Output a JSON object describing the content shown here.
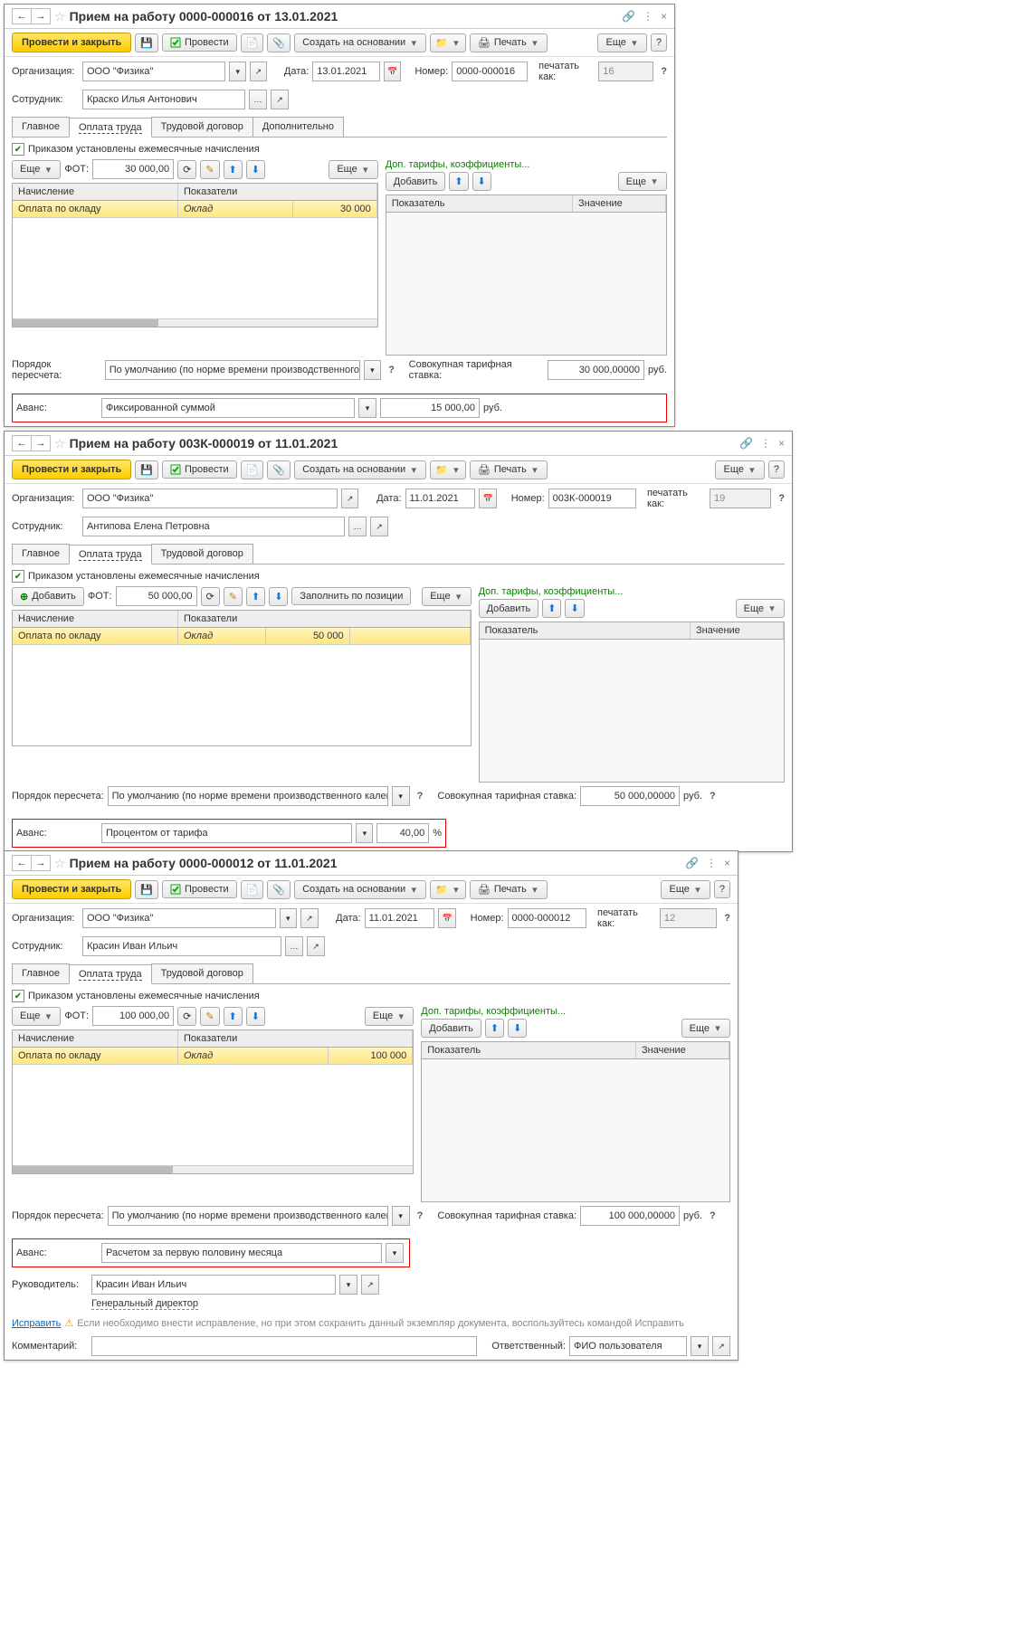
{
  "common": {
    "post_close": "Провести и закрыть",
    "post": "Провести",
    "create_based": "Создать на основании",
    "print": "Печать",
    "more": "Еще",
    "help": "?",
    "org_lbl": "Организация:",
    "emp_lbl": "Сотрудник:",
    "date_lbl": "Дата:",
    "num_lbl": "Номер:",
    "print_as_lbl": "печатать как:",
    "tab_main": "Главное",
    "tab_pay": "Оплата труда",
    "tab_contract": "Трудовой договор",
    "tab_extra": "Дополнительно",
    "monthly_check": "Приказом установлены ежемесячные начисления",
    "fot_lbl": "ФОТ:",
    "fill_pos": "Заполнить по позиции",
    "add": "Добавить",
    "col_accrual": "Начисление",
    "col_indicators": "Показатели",
    "col_indicator": "Показатель",
    "col_value": "Значение",
    "dop_tarif": "Доп. тарифы, коэффициенты...",
    "recalc_order_lbl": "Порядок пересчета:",
    "recalc_option": "По умолчанию (по норме времени производственного кале",
    "recalc_option2": "По умолчанию (по норме времени производственного календар",
    "cumul_rate_lbl": "Совокупная тарифная ставка:",
    "rub": "руб.",
    "advance_lbl": "Аванс:",
    "row_accrual": "Оплата по окладу",
    "row_indic": "Оклад"
  },
  "w1": {
    "title": "Прием на работу 0000-000016 от 13.01.2021",
    "org": "ООО \"Физика\"",
    "employee": "Краско Илья Антонович",
    "date": "13.01.2021",
    "number": "0000-000016",
    "print_as": "16",
    "fot": "30 000,00",
    "oklad": "30 000",
    "cumul_rate": "30 000,00000",
    "advance_type": "Фиксированной суммой",
    "advance_val": "15 000,00"
  },
  "w2": {
    "title": "Прием на работу 003К-000019 от 11.01.2021",
    "org": "ООО \"Физика\"",
    "employee": "Антипова Елена Петровна",
    "date": "11.01.2021",
    "number": "003К-000019",
    "print_as": "19",
    "fot": "50 000,00",
    "oklad": "50 000",
    "cumul_rate": "50 000,00000",
    "advance_type": "Процентом от тарифа",
    "advance_val": "40,00",
    "pct": "%"
  },
  "w3": {
    "title": "Прием на работу 0000-000012 от 11.01.2021",
    "org": "ООО \"Физика\"",
    "employee": "Красин Иван Ильич",
    "date": "11.01.2021",
    "number": "0000-000012",
    "print_as": "12",
    "fot": "100 000,00",
    "oklad": "100 000",
    "cumul_rate": "100 000,00000",
    "advance_type": "Расчетом за первую половину месяца",
    "manager_lbl": "Руководитель:",
    "manager": "Красин Иван Ильич",
    "manager_title": "Генеральный директор",
    "fix_link": "Исправить",
    "fix_note": "Если необходимо внести исправление, но при этом сохранить данный экземпляр документа, воспользуйтесь командой Исправить",
    "comment_lbl": "Комментарий:",
    "resp_lbl": "Ответственный:",
    "resp": "ФИО пользователя"
  }
}
